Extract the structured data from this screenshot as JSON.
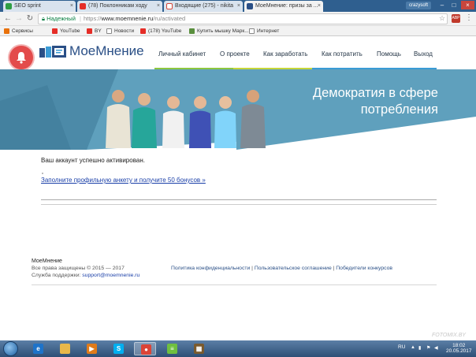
{
  "browser": {
    "tabs": [
      {
        "title": "SEO sprint",
        "active": false
      },
      {
        "title": "(78) Поклонникам ходу",
        "active": false
      },
      {
        "title": "Входящие (275) - nikita",
        "active": false
      },
      {
        "title": "МоеМнение: призы за ...",
        "active": true
      }
    ],
    "profile_name": "crazysoft",
    "window_controls": [
      "–",
      "□",
      "×"
    ],
    "secure_label": "Надежный",
    "url_scheme": "https://",
    "url_host": "www.moemnenie.ru",
    "url_path": "/ru/activated",
    "extension_badge": "ABP",
    "bookmarks": [
      {
        "label": "Сервисы",
        "icon": "apps-icon",
        "color": "#e8710a"
      },
      {
        "label": "YouTube",
        "icon": "youtube-icon",
        "color": "#e52d27"
      },
      {
        "label": "BY",
        "icon": "youtube-icon",
        "color": "#e52d27"
      },
      {
        "label": "Новости",
        "icon": "document-icon",
        "color": "#888888"
      },
      {
        "label": "(178) YouTube",
        "icon": "youtube-icon",
        "color": "#e52d27"
      },
      {
        "label": "Купить мышку Марк...",
        "icon": "mouse-icon",
        "color": "#5a8f3e"
      },
      {
        "label": "Интернет",
        "icon": "document-icon",
        "color": "#888888"
      }
    ]
  },
  "site": {
    "logo_text": "МоеМнение",
    "nav": [
      {
        "label": "Личный кабинет",
        "accent": "#8dc63f"
      },
      {
        "label": "О проекте",
        "accent": "#8dc63f"
      },
      {
        "label": "Как заработать",
        "accent": "#8dc63f"
      },
      {
        "label": "Как потратить",
        "accent": "#3a9bd5"
      },
      {
        "label": "Помощь",
        "accent": "#3a9bd5"
      },
      {
        "label": "Выход",
        "accent": "#3a9bd5"
      }
    ],
    "hero_title": "Демократия в сфере потребления",
    "colors": {
      "brand": "#2a4f86",
      "hero": "#5fa0bd",
      "alert": "#e34b4b"
    }
  },
  "main": {
    "message": "Ваш аккаунт успешно активирован.",
    "cta_link": "Заполните профильную анкету и получите 50 бонусов »"
  },
  "footer": {
    "brand": "МоеМнение",
    "copyright": "Все права защищены © 2015 — 2017",
    "support_label": "Служба поддержки:",
    "support_email": "support@moemnenie.ru",
    "links": [
      "Политика конфиденциальности",
      "Пользовательское соглашение",
      "Победители конкурсов"
    ],
    "link_separator": " | "
  },
  "watermark": "FOTOMIX.BY",
  "taskbar": {
    "apps": [
      {
        "name": "internet-explorer-icon",
        "color": "#1e73c9",
        "glyph": "e",
        "active": false
      },
      {
        "name": "folder-icon",
        "color": "#e8b84a",
        "glyph": "",
        "active": false
      },
      {
        "name": "media-player-icon",
        "color": "#e07b1a",
        "glyph": "▶",
        "active": false
      },
      {
        "name": "skype-icon",
        "color": "#00aff0",
        "glyph": "S",
        "active": false
      },
      {
        "name": "chrome-icon",
        "color": "#db4437",
        "glyph": "●",
        "active": true
      },
      {
        "name": "bluestacks-icon",
        "color": "#6fbf3f",
        "glyph": "≡",
        "active": false
      },
      {
        "name": "archive-icon",
        "color": "#7a5a2e",
        "glyph": "▦",
        "active": false
      }
    ],
    "language": "RU",
    "time": "18:02",
    "date": "20.05.2017"
  }
}
